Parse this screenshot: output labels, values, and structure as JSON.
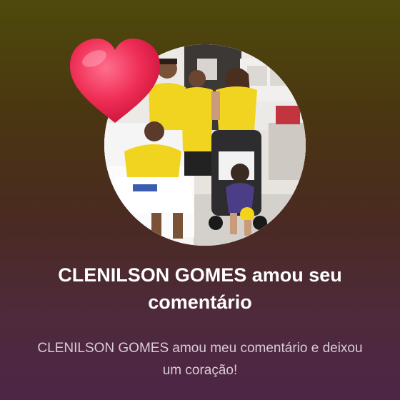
{
  "notification": {
    "title": "CLENILSON GOMES amou seu comentário",
    "message": "CLENILSON GOMES amou meu comentário e deixou um coração!"
  },
  "photo": {
    "icon": "family-photo"
  },
  "reaction": {
    "icon": "heart-icon",
    "color": "#e8284f"
  },
  "colors": {
    "background_top": "#4e4a0b",
    "background_bottom": "#4d2547",
    "title_text": "#ffffff",
    "message_text": "#d9ccd8"
  }
}
